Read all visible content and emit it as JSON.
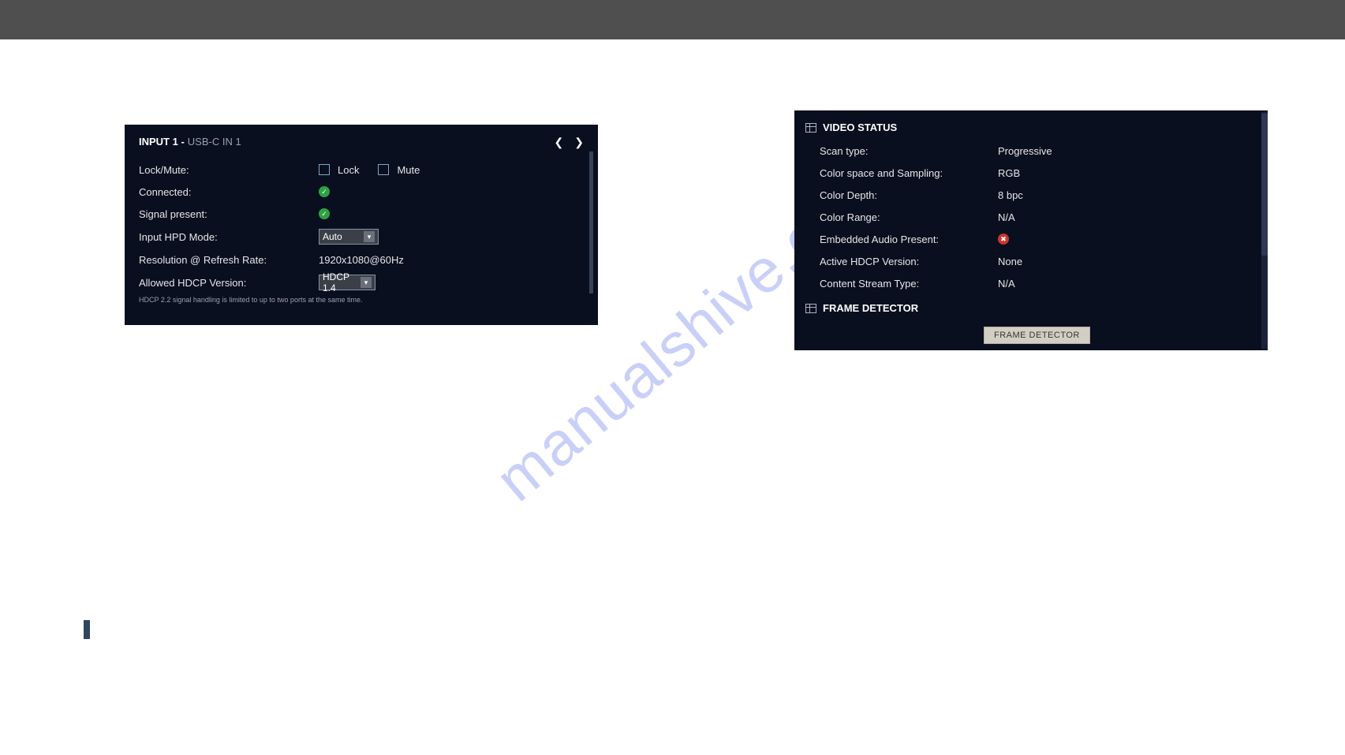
{
  "watermark": "manualshive.co",
  "left_panel": {
    "title_bold": "INPUT 1 -",
    "title_sub": "USB-C IN 1",
    "lock_mute_label": "Lock/Mute:",
    "lock_label": "Lock",
    "mute_label": "Mute",
    "connected_label": "Connected:",
    "signal_label": "Signal present:",
    "hpd_label": "Input HPD Mode:",
    "hpd_value": "Auto",
    "res_label": "Resolution @ Refresh Rate:",
    "res_value": "1920x1080@60Hz",
    "hdcp_label": "Allowed HDCP Version:",
    "hdcp_value": "HDCP 1.4",
    "footnote": "HDCP 2.2 signal handling is limited to up to two ports at the same time."
  },
  "right_panel": {
    "video_status_title": "VIDEO STATUS",
    "scan_label": "Scan type:",
    "scan_value": "Progressive",
    "cs_label": "Color space and Sampling:",
    "cs_value": "RGB",
    "cd_label": "Color Depth:",
    "cd_value": "8 bpc",
    "cr_label": "Color Range:",
    "cr_value": "N/A",
    "ea_label": "Embedded Audio Present:",
    "hdcp_label": "Active HDCP Version:",
    "hdcp_value": "None",
    "cst_label": "Content Stream Type:",
    "cst_value": "N/A",
    "fd_title": "FRAME DETECTOR",
    "fd_button": "FRAME DETECTOR"
  }
}
